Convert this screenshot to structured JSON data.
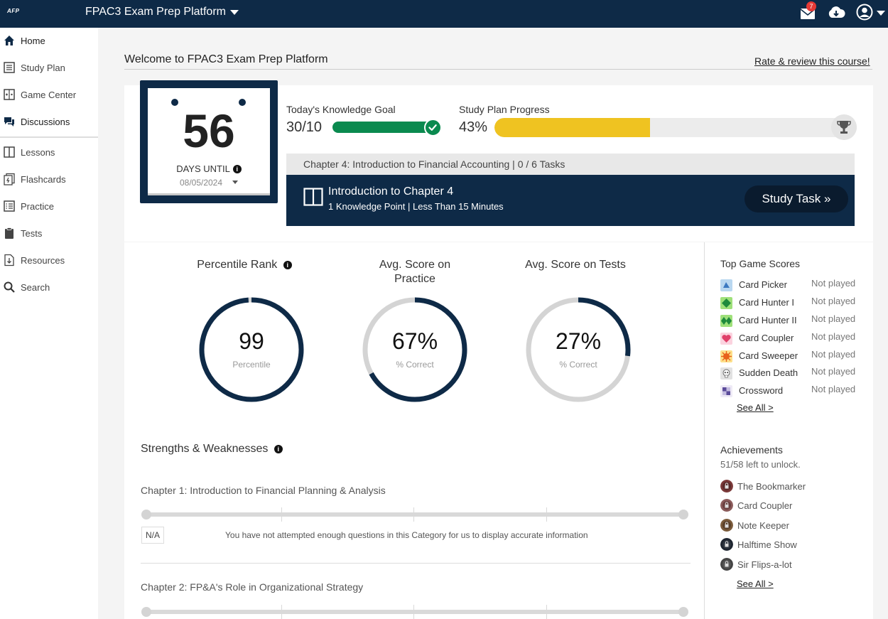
{
  "header": {
    "logo": "AFP",
    "app_title": "FPAC3 Exam Prep Platform",
    "mail_count": "7"
  },
  "sidebar": {
    "items": [
      {
        "label": "Home",
        "icon": "home-icon"
      },
      {
        "label": "Study Plan",
        "icon": "study-plan-icon"
      },
      {
        "label": "Game Center",
        "icon": "game-center-icon"
      },
      {
        "label": "Discussions",
        "icon": "discussions-icon"
      },
      {
        "label": "Lessons",
        "icon": "lessons-icon"
      },
      {
        "label": "Flashcards",
        "icon": "flashcards-icon"
      },
      {
        "label": "Practice",
        "icon": "practice-icon"
      },
      {
        "label": "Tests",
        "icon": "tests-icon"
      },
      {
        "label": "Resources",
        "icon": "resources-icon"
      },
      {
        "label": "Search",
        "icon": "search-icon"
      }
    ]
  },
  "main": {
    "welcome": "Welcome to FPAC3 Exam Prep Platform",
    "rate_link": "Rate & review this course!"
  },
  "countdown": {
    "days": "56",
    "label": "DAYS UNTIL",
    "date": "08/05/2024"
  },
  "knowledge_goal": {
    "label": "Today's Knowledge Goal",
    "value": "30/10",
    "progress": 1.0
  },
  "study_plan": {
    "label": "Study Plan Progress",
    "value": "43%",
    "progress": 0.43
  },
  "chapter": {
    "header": "Chapter 4: Introduction to Financial Accounting | 0 / 6 Tasks",
    "task_title": "Introduction to Chapter 4",
    "task_sub": "1 Knowledge Point |  Less Than 15 Minutes",
    "button": "Study Task"
  },
  "stats": [
    {
      "title": "Percentile Rank",
      "value": "99",
      "caption": "Percentile",
      "fraction": 0.99
    },
    {
      "title": "Avg. Score on Practice",
      "value": "67%",
      "caption": "% Correct",
      "fraction": 0.67
    },
    {
      "title": "Avg. Score on Tests",
      "value": "27%",
      "caption": "% Correct",
      "fraction": 0.27
    }
  ],
  "strengths": {
    "title": "Strengths & Weaknesses",
    "chapters": [
      {
        "title": "Chapter 1: Introduction to Financial Planning & Analysis",
        "badge": "N/A",
        "message": "You have not attempted enough questions in this Category for us to display accurate information"
      },
      {
        "title": "Chapter 2: FP&A's Role in Organizational Strategy"
      }
    ]
  },
  "games": {
    "title": "Top Game Scores",
    "items": [
      {
        "name": "Card Picker",
        "score": "Not played",
        "color": "#6fa8dc"
      },
      {
        "name": "Card Hunter I",
        "score": "Not played",
        "color": "#3aa84a"
      },
      {
        "name": "Card Hunter II",
        "score": "Not played",
        "color": "#3aa84a"
      },
      {
        "name": "Card Coupler",
        "score": "Not played",
        "color": "#e06080"
      },
      {
        "name": "Card Sweeper",
        "score": "Not played",
        "color": "#f0a030"
      },
      {
        "name": "Sudden Death",
        "score": "Not played",
        "color": "#bbbbbb"
      },
      {
        "name": "Crossword",
        "score": "Not played",
        "color": "#8a7ab8"
      }
    ],
    "see_all": "See All >"
  },
  "achievements": {
    "title": "Achievements",
    "subtitle": "51/58 left to unlock.",
    "items": [
      {
        "name": "The Bookmarker"
      },
      {
        "name": "Card Coupler"
      },
      {
        "name": "Note Keeper"
      },
      {
        "name": "Halftime Show"
      },
      {
        "name": "Sir Flips-a-lot"
      }
    ],
    "see_all": "See All >"
  },
  "colors": {
    "navy": "#0e2a47",
    "green": "#0a8a4f",
    "yellow": "#efc321"
  }
}
